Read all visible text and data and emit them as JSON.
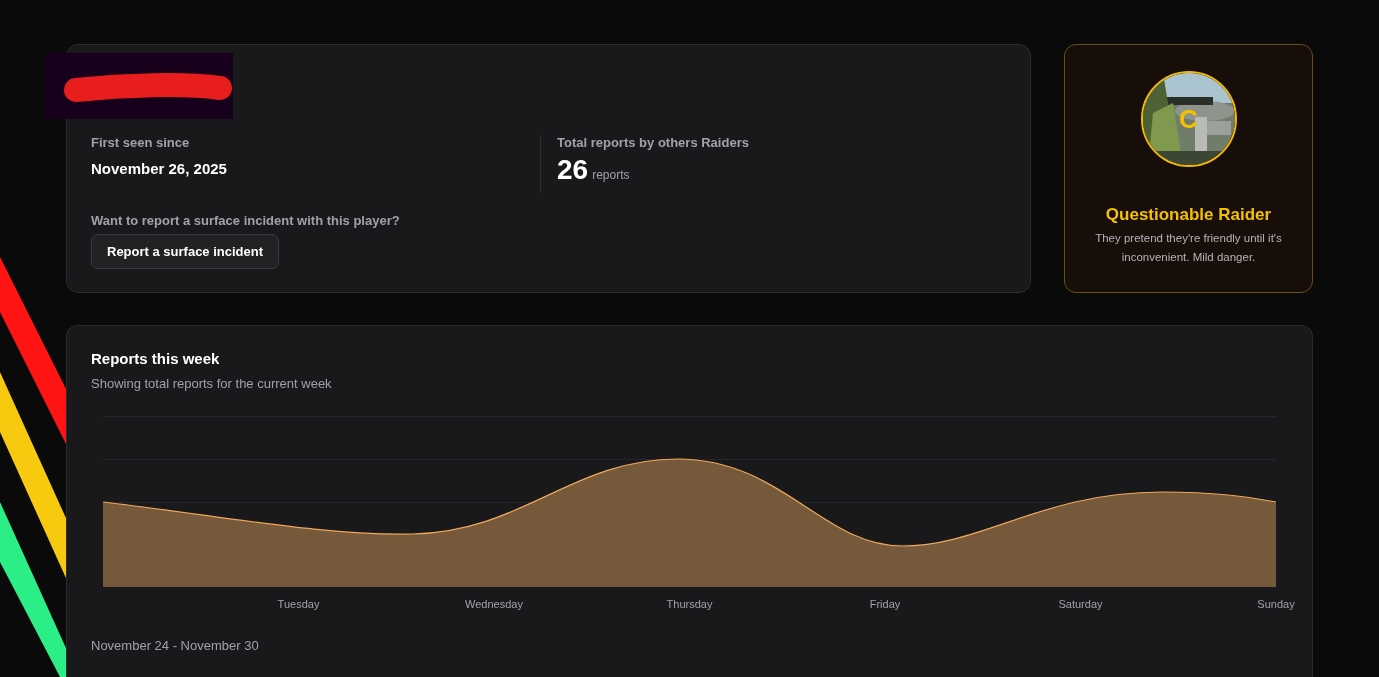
{
  "player": {
    "redacted": true
  },
  "first_seen": {
    "label": "First seen since",
    "value": "November 26, 2025"
  },
  "reports_total": {
    "label": "Total reports by others Raiders",
    "count": "26",
    "unit": "reports"
  },
  "report_prompt": {
    "text": "Want to report a surface incident with this player?",
    "button": "Report a surface incident"
  },
  "rank": {
    "avatar_letter": "C",
    "title": "Questionable Raider",
    "description": "They pretend they're friendly until it's inconvenient. Mild danger."
  },
  "weekly_chart": {
    "title": "Reports this week",
    "subtitle": "Showing total reports for the current week",
    "x_labels": [
      "Tuesday",
      "Wednesday",
      "Thursday",
      "Friday",
      "Saturday",
      "Sunday"
    ],
    "range": "November 24 - November 30"
  }
}
